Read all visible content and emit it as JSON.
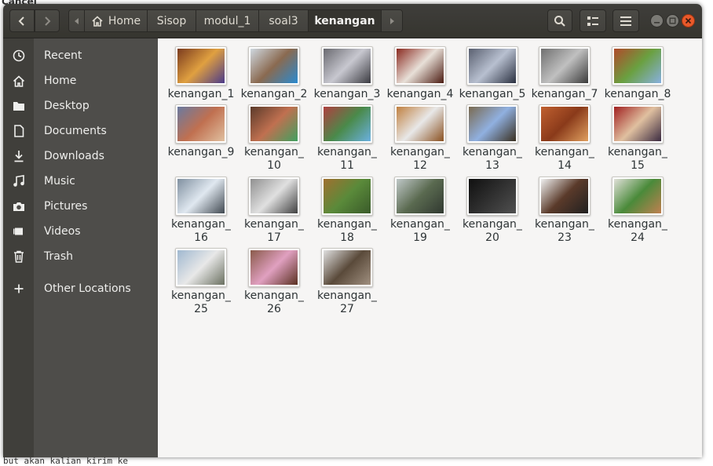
{
  "background": {
    "cancel_text": "Cancel",
    "bottom_text": "but akan kalian kirim ke"
  },
  "header": {
    "breadcrumb": [
      "Home",
      "Sisop",
      "modul_1",
      "soal3",
      "kenangan"
    ],
    "active_segment": "kenangan"
  },
  "sidebar": {
    "items": [
      {
        "label": "Recent",
        "icon": "clock-icon"
      },
      {
        "label": "Home",
        "icon": "home-icon"
      },
      {
        "label": "Desktop",
        "icon": "folder-icon"
      },
      {
        "label": "Documents",
        "icon": "document-icon"
      },
      {
        "label": "Downloads",
        "icon": "download-icon"
      },
      {
        "label": "Music",
        "icon": "music-icon"
      },
      {
        "label": "Pictures",
        "icon": "camera-icon"
      },
      {
        "label": "Videos",
        "icon": "video-icon"
      },
      {
        "label": "Trash",
        "icon": "trash-icon"
      },
      {
        "label": "Other Locations",
        "icon": "plus-icon"
      }
    ]
  },
  "files": [
    {
      "line1": "kenangan_1",
      "line2": "",
      "colors": [
        "#7a3a1e",
        "#e0a040",
        "#4a3a8a"
      ]
    },
    {
      "line1": "kenangan_2",
      "line2": "",
      "colors": [
        "#cfd8e0",
        "#8a6a50",
        "#2a8ad0"
      ]
    },
    {
      "line1": "kenangan_3",
      "line2": "",
      "colors": [
        "#6a6a70",
        "#c8c8d0",
        "#3a3a40"
      ]
    },
    {
      "line1": "kenangan_4",
      "line2": "",
      "colors": [
        "#8a2a20",
        "#e8e0d8",
        "#4a1a10"
      ]
    },
    {
      "line1": "kenangan_5",
      "line2": "",
      "colors": [
        "#5a6070",
        "#b8c0d0",
        "#2a3040"
      ]
    },
    {
      "line1": "kenangan_7",
      "line2": "",
      "colors": [
        "#707070",
        "#c0c0c0",
        "#3a3a3a"
      ]
    },
    {
      "line1": "kenangan_8",
      "line2": "",
      "colors": [
        "#b04a2a",
        "#6aa040",
        "#88b0e0"
      ]
    },
    {
      "line1": "kenangan_9",
      "line2": "",
      "colors": [
        "#6a7aa0",
        "#c07050",
        "#e0c0a0"
      ]
    },
    {
      "line1": "kenangan_",
      "line2": "10",
      "colors": [
        "#5a3a2a",
        "#c07050",
        "#40a060"
      ]
    },
    {
      "line1": "kenangan_",
      "line2": "11",
      "colors": [
        "#b04040",
        "#4a8a4a",
        "#6ab0e0"
      ]
    },
    {
      "line1": "kenangan_",
      "line2": "12",
      "colors": [
        "#c08040",
        "#e8e8e8",
        "#8a5020"
      ]
    },
    {
      "line1": "kenangan_",
      "line2": "13",
      "colors": [
        "#7a6a50",
        "#90b0e0",
        "#3a3020"
      ]
    },
    {
      "line1": "kenangan_",
      "line2": "14",
      "colors": [
        "#c06030",
        "#8a3a1a",
        "#e0a060"
      ]
    },
    {
      "line1": "kenangan_",
      "line2": "15",
      "colors": [
        "#a02020",
        "#e0c0a0",
        "#3a2a40"
      ]
    },
    {
      "line1": "kenangan_",
      "line2": "16",
      "colors": [
        "#8090a0",
        "#e0e8f0",
        "#404850"
      ]
    },
    {
      "line1": "kenangan_",
      "line2": "17",
      "colors": [
        "#909090",
        "#e0e0e0",
        "#404040"
      ]
    },
    {
      "line1": "kenangan_",
      "line2": "18",
      "colors": [
        "#a07030",
        "#5a8a3a",
        "#3a5a2a"
      ]
    },
    {
      "line1": "kenangan_",
      "line2": "19",
      "colors": [
        "#c0c8c8",
        "#5a6a50",
        "#303830"
      ]
    },
    {
      "line1": "kenangan_",
      "line2": "20",
      "colors": [
        "#101010",
        "#303030",
        "#505050"
      ]
    },
    {
      "line1": "kenangan_",
      "line2": "23",
      "colors": [
        "#f0f0f0",
        "#5a3a2a",
        "#202020"
      ]
    },
    {
      "line1": "kenangan_",
      "line2": "24",
      "colors": [
        "#e0e0d8",
        "#4a8a3a",
        "#c08050"
      ]
    },
    {
      "line1": "kenangan_",
      "line2": "25",
      "colors": [
        "#a0b8d0",
        "#e8e8e8",
        "#6a7060"
      ]
    },
    {
      "line1": "kenangan_",
      "line2": "26",
      "colors": [
        "#8a5a4a",
        "#e0a0c0",
        "#5a3020"
      ]
    },
    {
      "line1": "kenangan_",
      "line2": "27",
      "colors": [
        "#e0e0e0",
        "#5a4a3a",
        "#a09080"
      ]
    }
  ],
  "colors": {
    "header": "#3c3b37",
    "sidebar": "#4e4d4a",
    "sidebar_icon_strip": "#403f3b",
    "content": "#f6f5f4",
    "close_button": "#e9592a"
  }
}
